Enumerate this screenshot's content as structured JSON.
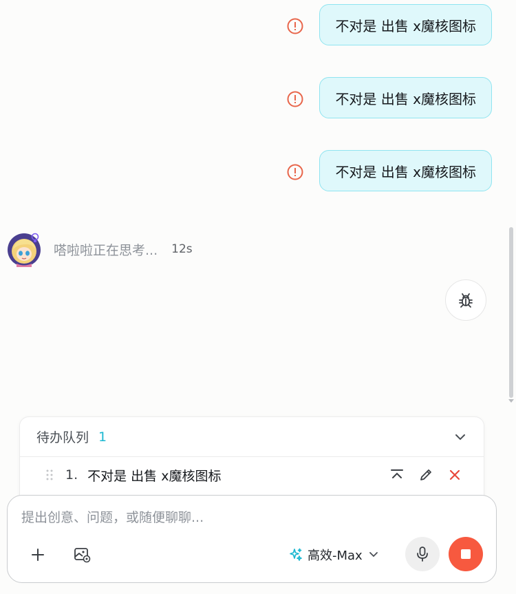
{
  "messages": [
    {
      "text": "不对是 出售 x魔核图标",
      "status_icon": "error-icon"
    },
    {
      "text": "不对是 出售 x魔核图标",
      "status_icon": "error-icon"
    },
    {
      "text": "不对是 出售 x魔核图标",
      "status_icon": "error-icon"
    }
  ],
  "assistant": {
    "thinking_text": "嗒啦啦正在思考...",
    "elapsed": "12s",
    "avatar_icon": "anime-character-avatar",
    "badge_icon": "lightbulb-icon"
  },
  "debug_button": {
    "icon": "bug-icon"
  },
  "queue": {
    "title": "待办队列",
    "count": "1",
    "items": [
      {
        "number": "1.",
        "text": "不对是 出售 x魔核图标"
      }
    ]
  },
  "composer": {
    "placeholder": "提出创意、问题，或随便聊聊...",
    "value": "",
    "model_label": "高效-Max",
    "model_icon": "sparkles-icon"
  },
  "colors": {
    "bubble_bg": "#dff8fb",
    "bubble_border": "#8fe4f0",
    "error": "#e8654a",
    "accent": "#1bb8d1",
    "stop": "#f7593f",
    "remove": "#e8473a"
  }
}
